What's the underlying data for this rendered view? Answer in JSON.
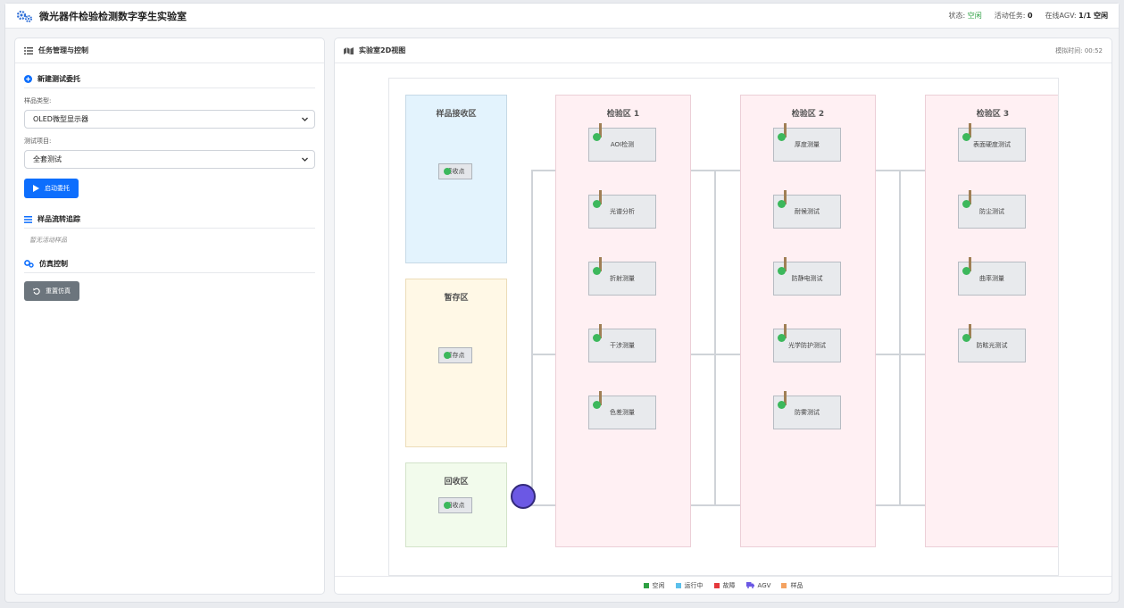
{
  "header": {
    "title": "微光器件检验检测数字孪生实验室",
    "status_label": "状态:",
    "status_value": "空闲",
    "tasks_label": "活动任务:",
    "tasks_value": "0",
    "agv_label": "在线AGV:",
    "agv_value": "1/1 空闲",
    "logo_icon": "gears-icon"
  },
  "left_panel": {
    "title": "任务管理与控制",
    "new_task": {
      "title": "新建测试委托",
      "sample_type_label": "样品类型:",
      "sample_type_value": "OLED微型显示器",
      "test_item_label": "测试项目:",
      "test_item_value": "全套测试",
      "start_button": "启动委托"
    },
    "tracking": {
      "title": "样品流转追踪",
      "empty_text": "暂无活动样品"
    },
    "sim_control": {
      "title": "仿真控制",
      "reset_button": "重置仿真"
    }
  },
  "view": {
    "title": "实验室2D视图",
    "sim_time_label": "模拟时间:",
    "sim_time_value": "00:52",
    "zones": {
      "receive": {
        "title": "样品接收区",
        "point": "接收点"
      },
      "storage": {
        "title": "暂存区",
        "point": "暂存点"
      },
      "recycle": {
        "title": "回收区",
        "point": "回收点"
      },
      "test1": {
        "title": "检验区 1",
        "stations": [
          "AOI检测",
          "光谱分析",
          "折射测量",
          "干涉测量",
          "色差测量"
        ]
      },
      "test2": {
        "title": "检验区 2",
        "stations": [
          "厚度测量",
          "耐候测试",
          "防静电测试",
          "光学防护测试",
          "防雾测试"
        ]
      },
      "test3": {
        "title": "检验区 3",
        "stations": [
          "表面硬度测试",
          "防尘测试",
          "曲率测量",
          "防眩光测试"
        ]
      }
    },
    "legend": [
      {
        "label": "空闲",
        "color": "#2ea043"
      },
      {
        "label": "运行中",
        "color": "#5bc0eb"
      },
      {
        "label": "故障",
        "color": "#e5383b"
      },
      {
        "label": "AGV",
        "color": "#6b58e4"
      },
      {
        "label": "样品",
        "color": "#f4a261"
      }
    ]
  }
}
